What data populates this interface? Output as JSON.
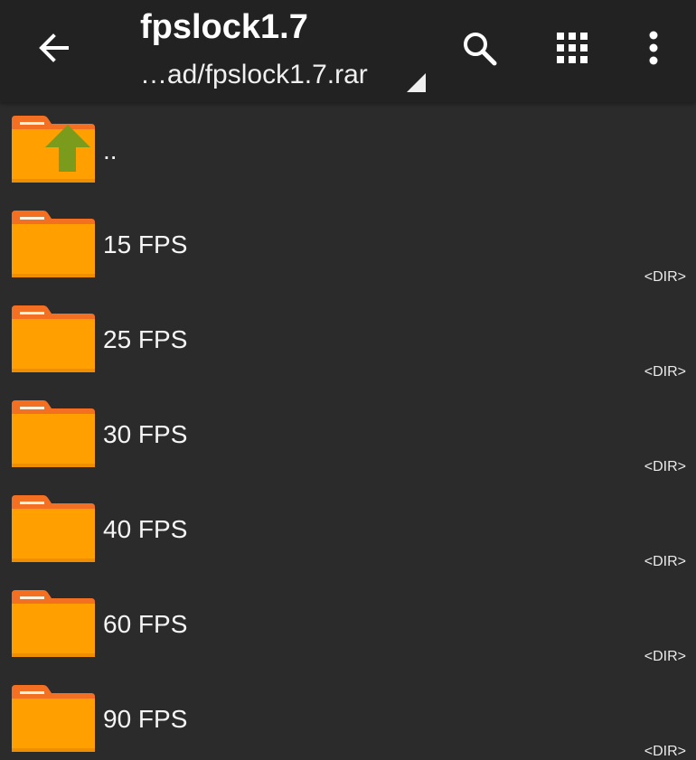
{
  "header": {
    "title": "fpslock1.7",
    "path": "…ad/fpslock1.7.rar",
    "back_icon": "arrow-back-icon",
    "search_icon": "search-icon",
    "grid_icon": "grid-view-icon",
    "more_icon": "more-vert-icon"
  },
  "parent": {
    "name": ".."
  },
  "items": [
    {
      "name": "15 FPS",
      "type": "<DIR>"
    },
    {
      "name": "25 FPS",
      "type": "<DIR>"
    },
    {
      "name": "30 FPS",
      "type": "<DIR>"
    },
    {
      "name": "40 FPS",
      "type": "<DIR>"
    },
    {
      "name": "60 FPS",
      "type": "<DIR>"
    },
    {
      "name": "90 FPS",
      "type": "<DIR>"
    }
  ],
  "colors": {
    "toolbar": "#222222",
    "background": "#2b2b2b",
    "folder": "#ffa000",
    "folder_tab": "#f36f21",
    "up_arrow": "#7b9b1d"
  }
}
